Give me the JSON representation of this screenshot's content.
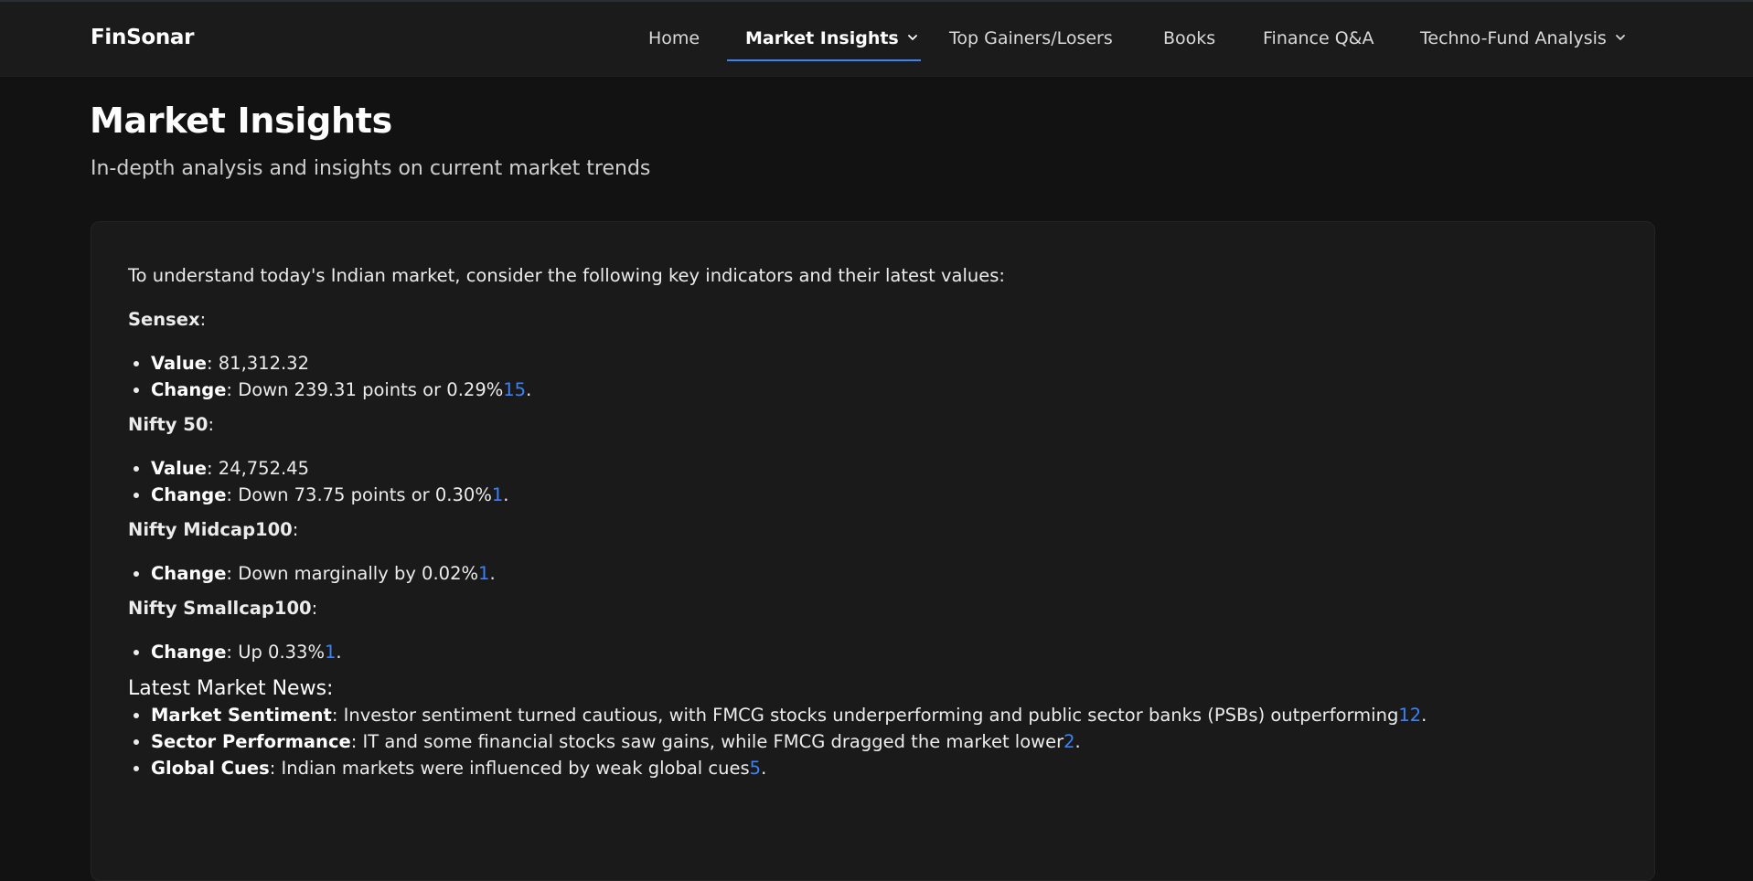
{
  "brand": "FinSonar",
  "nav": {
    "home": "Home",
    "market_insights": "Market Insights",
    "top_gainers": "Top Gainers/Losers",
    "books": "Books",
    "finance_qa": "Finance Q&A",
    "techno_fund": "Techno-Fund Analysis"
  },
  "header": {
    "title": "Market Insights",
    "subtitle": "In-depth analysis and insights on current market trends"
  },
  "content": {
    "intro": "To understand today's Indian market, consider the following key indicators and their latest values:",
    "sensex": {
      "label": "Sensex",
      "value_label": "Value",
      "value": ": 81,312.32",
      "change_label": "Change",
      "change": ": Down 239.31 points or 0.29%",
      "ref": "15"
    },
    "nifty50": {
      "label": "Nifty 50",
      "value_label": "Value",
      "value": ": 24,752.45",
      "change_label": "Change",
      "change": ": Down 73.75 points or 0.30%",
      "ref": "1"
    },
    "midcap": {
      "label": "Nifty Midcap100",
      "change_label": "Change",
      "change": ": Down marginally by 0.02%",
      "ref": "1"
    },
    "smallcap": {
      "label": "Nifty Smallcap100",
      "change_label": "Change",
      "change": ": Up 0.33%",
      "ref": "1"
    },
    "news": {
      "title": "Latest Market News:",
      "items": [
        {
          "label": "Market Sentiment",
          "text": ": Investor sentiment turned cautious, with FMCG stocks underperforming and public sector banks (PSBs) outperforming",
          "ref": "12"
        },
        {
          "label": "Sector Performance",
          "text": ": IT and some financial stocks saw gains, while FMCG dragged the market lower",
          "ref": "2"
        },
        {
          "label": "Global Cues",
          "text": ": Indian markets were influenced by weak global cues",
          "ref": "5"
        }
      ]
    }
  },
  "colors": {
    "accent": "#3b82f6",
    "background": "#121212",
    "navbar": "#1b1b1b",
    "card": "#1a1a1a"
  }
}
